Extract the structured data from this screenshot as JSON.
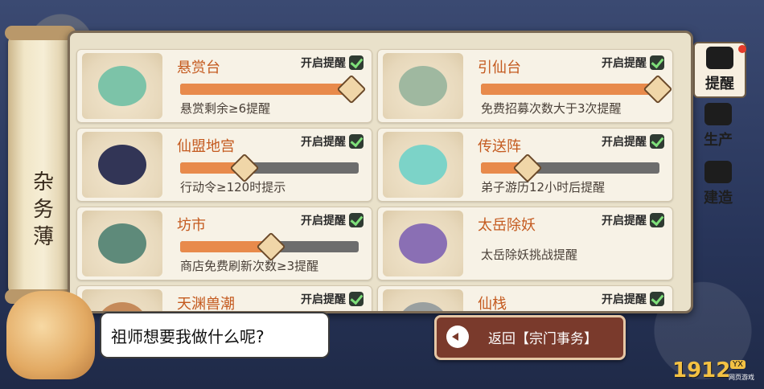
{
  "scroll": {
    "title": "杂务薄"
  },
  "cards": [
    {
      "name": "悬赏台",
      "toggle": "开启提醒",
      "progress": 0.95,
      "desc": "悬赏剩余≥6提醒",
      "icon": "pavilion-icon"
    },
    {
      "name": "引仙台",
      "toggle": "开启提醒",
      "progress": 0.98,
      "desc": "免费招募次数大于3次提醒",
      "icon": "platform-icon"
    },
    {
      "name": "仙盟地宫",
      "toggle": "开启提醒",
      "progress": 0.35,
      "desc": "行动令≥120时提示",
      "icon": "palace-icon"
    },
    {
      "name": "传送阵",
      "toggle": "开启提醒",
      "progress": 0.25,
      "desc": "弟子游历12小时后提醒",
      "icon": "teleport-icon"
    },
    {
      "name": "坊市",
      "toggle": "开启提醒",
      "progress": 0.5,
      "desc": "商店免费刷新次数≥3提醒",
      "icon": "market-icon"
    },
    {
      "name": "太岳除妖",
      "toggle": "开启提醒",
      "progress": null,
      "desc": "太岳除妖挑战提醒",
      "icon": "demon-icon"
    },
    {
      "name": "天渊兽潮",
      "toggle": "开启提醒",
      "progress": null,
      "desc": "",
      "icon": "beast-icon"
    },
    {
      "name": "仙栈",
      "toggle": "开启提醒",
      "progress": null,
      "desc": "",
      "icon": "inn-icon"
    }
  ],
  "tabs": [
    {
      "label": "提醒",
      "icon": "scroll-icon",
      "active": true,
      "badge": true
    },
    {
      "label": "生产",
      "icon": "plant-icon",
      "active": false,
      "badge": false
    },
    {
      "label": "建造",
      "icon": "hammer-icon",
      "active": false,
      "badge": false
    }
  ],
  "bubble": {
    "text": "祖师想要我做什么呢?"
  },
  "back_button": {
    "label": "返回【宗门事务】"
  },
  "logo": {
    "number": "1912",
    "yx": "YX",
    "sub": "网页游戏"
  }
}
